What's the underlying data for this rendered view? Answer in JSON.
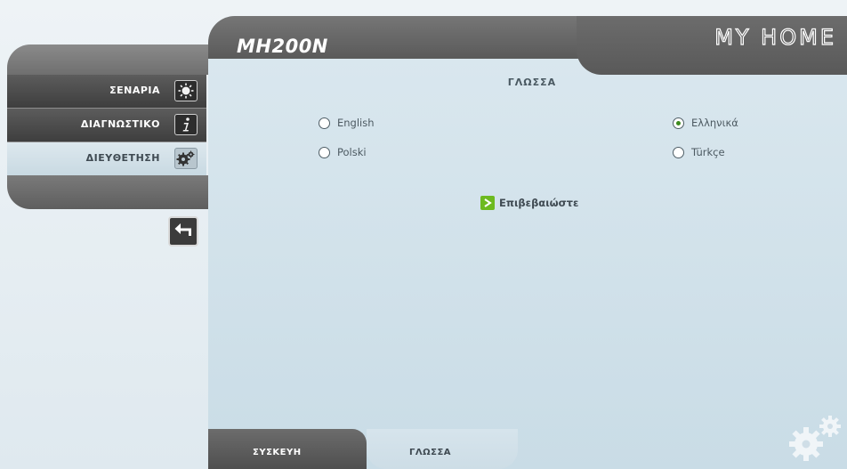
{
  "sidebar": {
    "items": [
      {
        "label": "ΣΕΝΑΡΙΑ",
        "icon": "scenarios-sun-icon"
      },
      {
        "label": "ΔΙΑΓΝΩΣΤΙΚΟ",
        "icon": "info-icon"
      },
      {
        "label": "ΔΙΕΥΘΕΤΗΣΗ",
        "icon": "gears-icon",
        "selected": true
      }
    ],
    "back_icon": "back-arrow-icon"
  },
  "header": {
    "device_title": "MH200N",
    "brand": "MY HOME"
  },
  "main": {
    "section_title": "ΓΛΩΣΣΑ",
    "languages": [
      {
        "label": "English",
        "checked": false
      },
      {
        "label": "Polski",
        "checked": false
      },
      {
        "label": "Ελληνικά",
        "checked": true
      },
      {
        "label": "Türkçe",
        "checked": false
      }
    ],
    "confirm_label": "Επιβεβαιώστε"
  },
  "tabs": [
    {
      "label": "ΣΥΣΚΕΥΗ"
    },
    {
      "label": "ΓΛΩΣΣΑ",
      "active": true
    }
  ],
  "colors": {
    "accent_green": "#6dba1f",
    "header_gray": "#666666",
    "panel_blue": "#d3e3eb"
  }
}
